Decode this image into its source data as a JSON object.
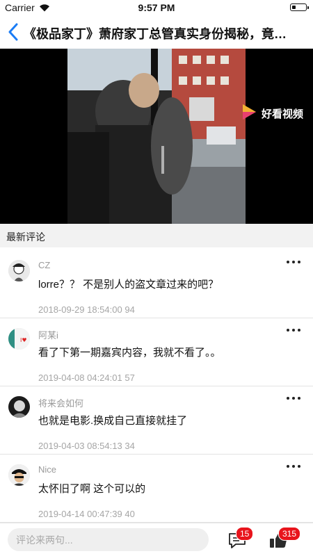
{
  "status_bar": {
    "carrier": "Carrier",
    "time": "9:57 PM"
  },
  "nav": {
    "title": "《极品家丁》萧府家丁总管真实身份揭秘，竟…"
  },
  "video": {
    "watermark": "好看视频"
  },
  "section": {
    "title": "最新评论"
  },
  "comments": [
    {
      "name": "CZ",
      "text": "lorre？？ 不是别人的盗文章过来的吧？",
      "time": "2018-09-29 18:54:00",
      "likes": "94"
    },
    {
      "name": "阿某i",
      "text": "看了下第一期嘉宾内容，我就不看了。。",
      "time": "2019-04-08 04:24:01",
      "likes": "57"
    },
    {
      "name": "将来会如何",
      "text": "也就是电影.换成自己直接就挂了",
      "time": "2019-04-03 08:54:13",
      "likes": "34"
    },
    {
      "name": "Nice",
      "text": "太怀旧了啊 这个可以的",
      "time": "2019-04-14 00:47:39",
      "likes": "40"
    }
  ],
  "bottom_bar": {
    "placeholder": "评论来两句...",
    "comment_count": "15",
    "like_count": "315"
  },
  "colors": {
    "accent": "#1a7cf5",
    "badge": "#e8141c"
  }
}
